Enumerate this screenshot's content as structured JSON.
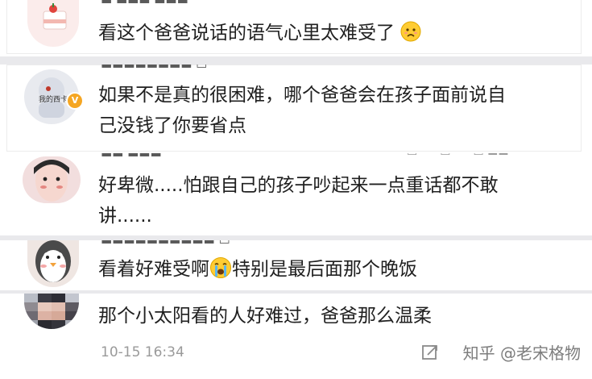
{
  "comments": [
    {
      "text": "看这个爸爸说话的语气心里太难受了",
      "emoji": "sad-face-emoji"
    },
    {
      "line1": "如果不是真的很困难，哪个爸爸会在孩子面前说自",
      "line2": "己没钱了你要省点",
      "avatar_label": "我的西卡"
    },
    {
      "line1": "好卑微.....怕跟自己的孩子吵起来一点重话都不敢",
      "line2": "讲......"
    },
    {
      "text_before": "看着好难受啊",
      "text_after": "特别是最后面那个晚饭",
      "emoji": "crying-face-emoji"
    },
    {
      "text": "那个小太阳看的人好难过，爸爸那么温柔"
    }
  ],
  "timestamp": "10-15 16:34",
  "watermark": "知乎 @老宋格物",
  "colors": {
    "verified": "#f5a623",
    "separator": "#e9e9ec",
    "meta": "#9a9a9a"
  }
}
